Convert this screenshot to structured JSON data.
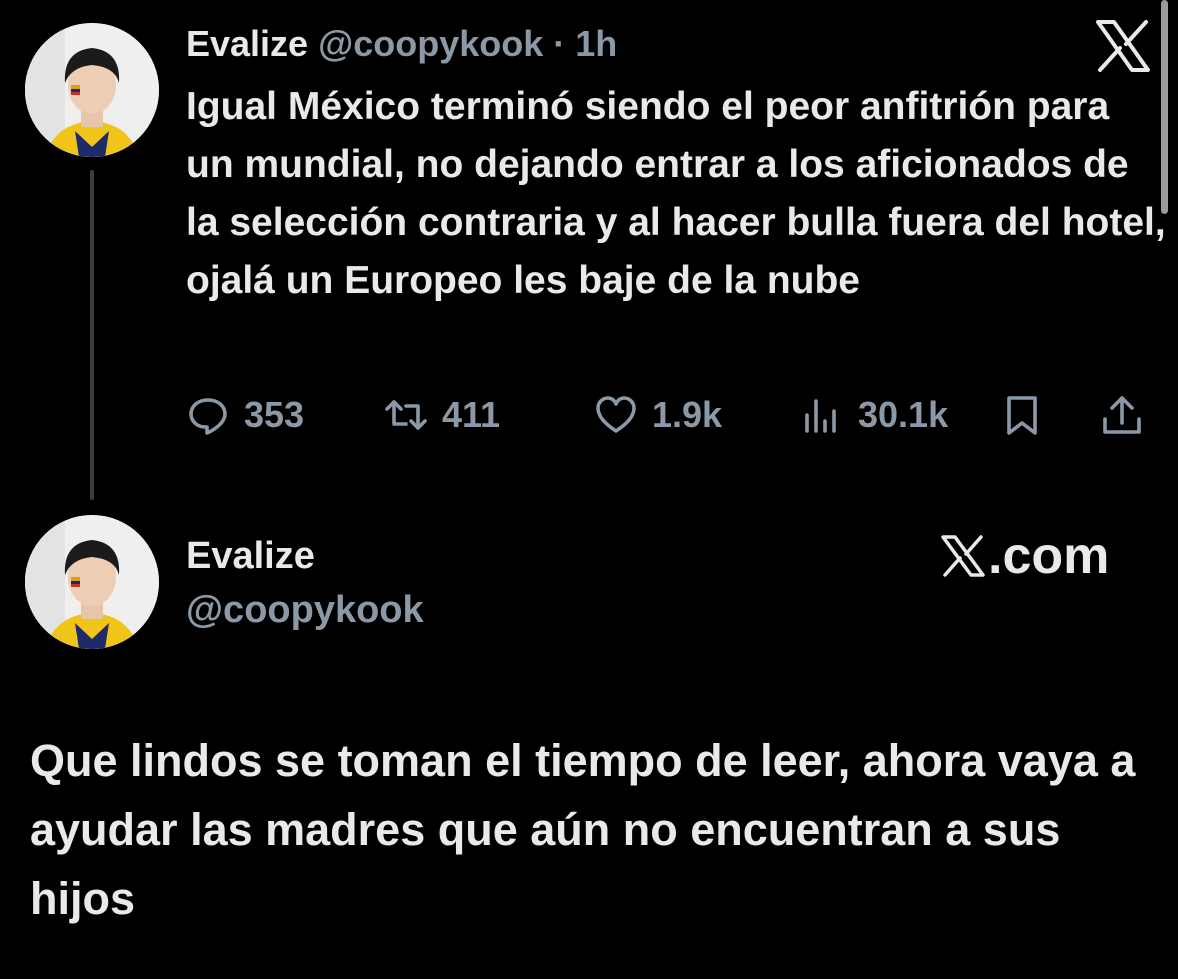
{
  "tweet1": {
    "name": "Evalize",
    "handle": "@coopykook",
    "separator": "·",
    "time": "1h",
    "text": "Igual México terminó siendo el peor anfitrión para un mundial, no dejando entrar a los aficionados de la selección contraria y al hacer bulla fuera del hotel, ojalá un Europeo les baje de la nube",
    "actions": {
      "replies": "353",
      "reposts": "411",
      "likes": "1.9k",
      "views": "30.1k"
    }
  },
  "tweet2": {
    "name": "Evalize",
    "handle": "@coopykook",
    "site": ".com",
    "text": "Que lindos se toman el tiempo de leer, ahora vaya a ayudar las madres que aún no encuentran a sus hijos"
  },
  "icons": {
    "platform": "x-logo-icon",
    "reply": "reply-icon",
    "repost": "repost-icon",
    "like": "heart-icon",
    "views": "views-icon",
    "bookmark": "bookmark-icon",
    "share": "share-icon"
  },
  "colors": {
    "background": "#000000",
    "primary_text": "#e7e9ea",
    "secondary_text": "#8b98a5"
  }
}
